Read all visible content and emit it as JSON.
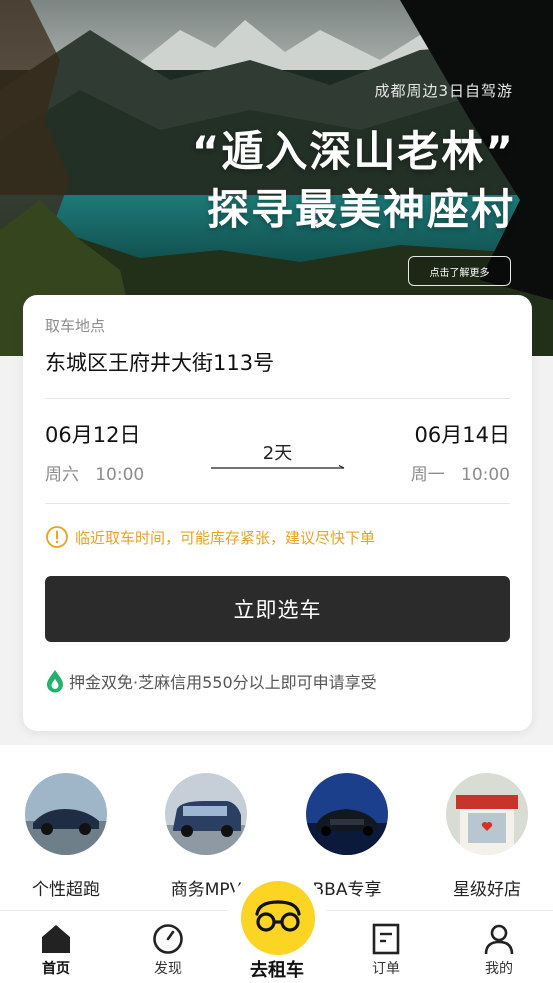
{
  "hero": {
    "subtitle": "成都周边3日自驾游",
    "title_line1": "“遁入深山老林”",
    "title_line2": "探寻最美神座村",
    "more_button": "点击了解更多"
  },
  "booking": {
    "pickup_label": "取车地点",
    "pickup_address": "东城区王府井大街113号",
    "start_date": "06月12日",
    "start_weekday": "周六",
    "start_time": "10:00",
    "end_date": "06月14日",
    "end_weekday": "周一",
    "end_time": "10:00",
    "duration": "2天",
    "warning": "临近取车时间，可能库存紧张，建议尽快下单",
    "cta": "立即选车",
    "deposit_note": "押金双免·芝麻信用550分以上即可申请享受"
  },
  "categories": [
    {
      "label": "个性超跑"
    },
    {
      "label": "商务MPV"
    },
    {
      "label": "BBA专享"
    },
    {
      "label": "星级好店"
    }
  ],
  "nav": {
    "home": "首页",
    "discover": "发现",
    "center": "去租车",
    "orders": "订单",
    "mine": "我的"
  },
  "colors": {
    "accent_yellow": "#fcd424",
    "warning": "#f0a21b",
    "cta_bg": "#2b2b2b",
    "deposit_green": "#1fb36b"
  }
}
